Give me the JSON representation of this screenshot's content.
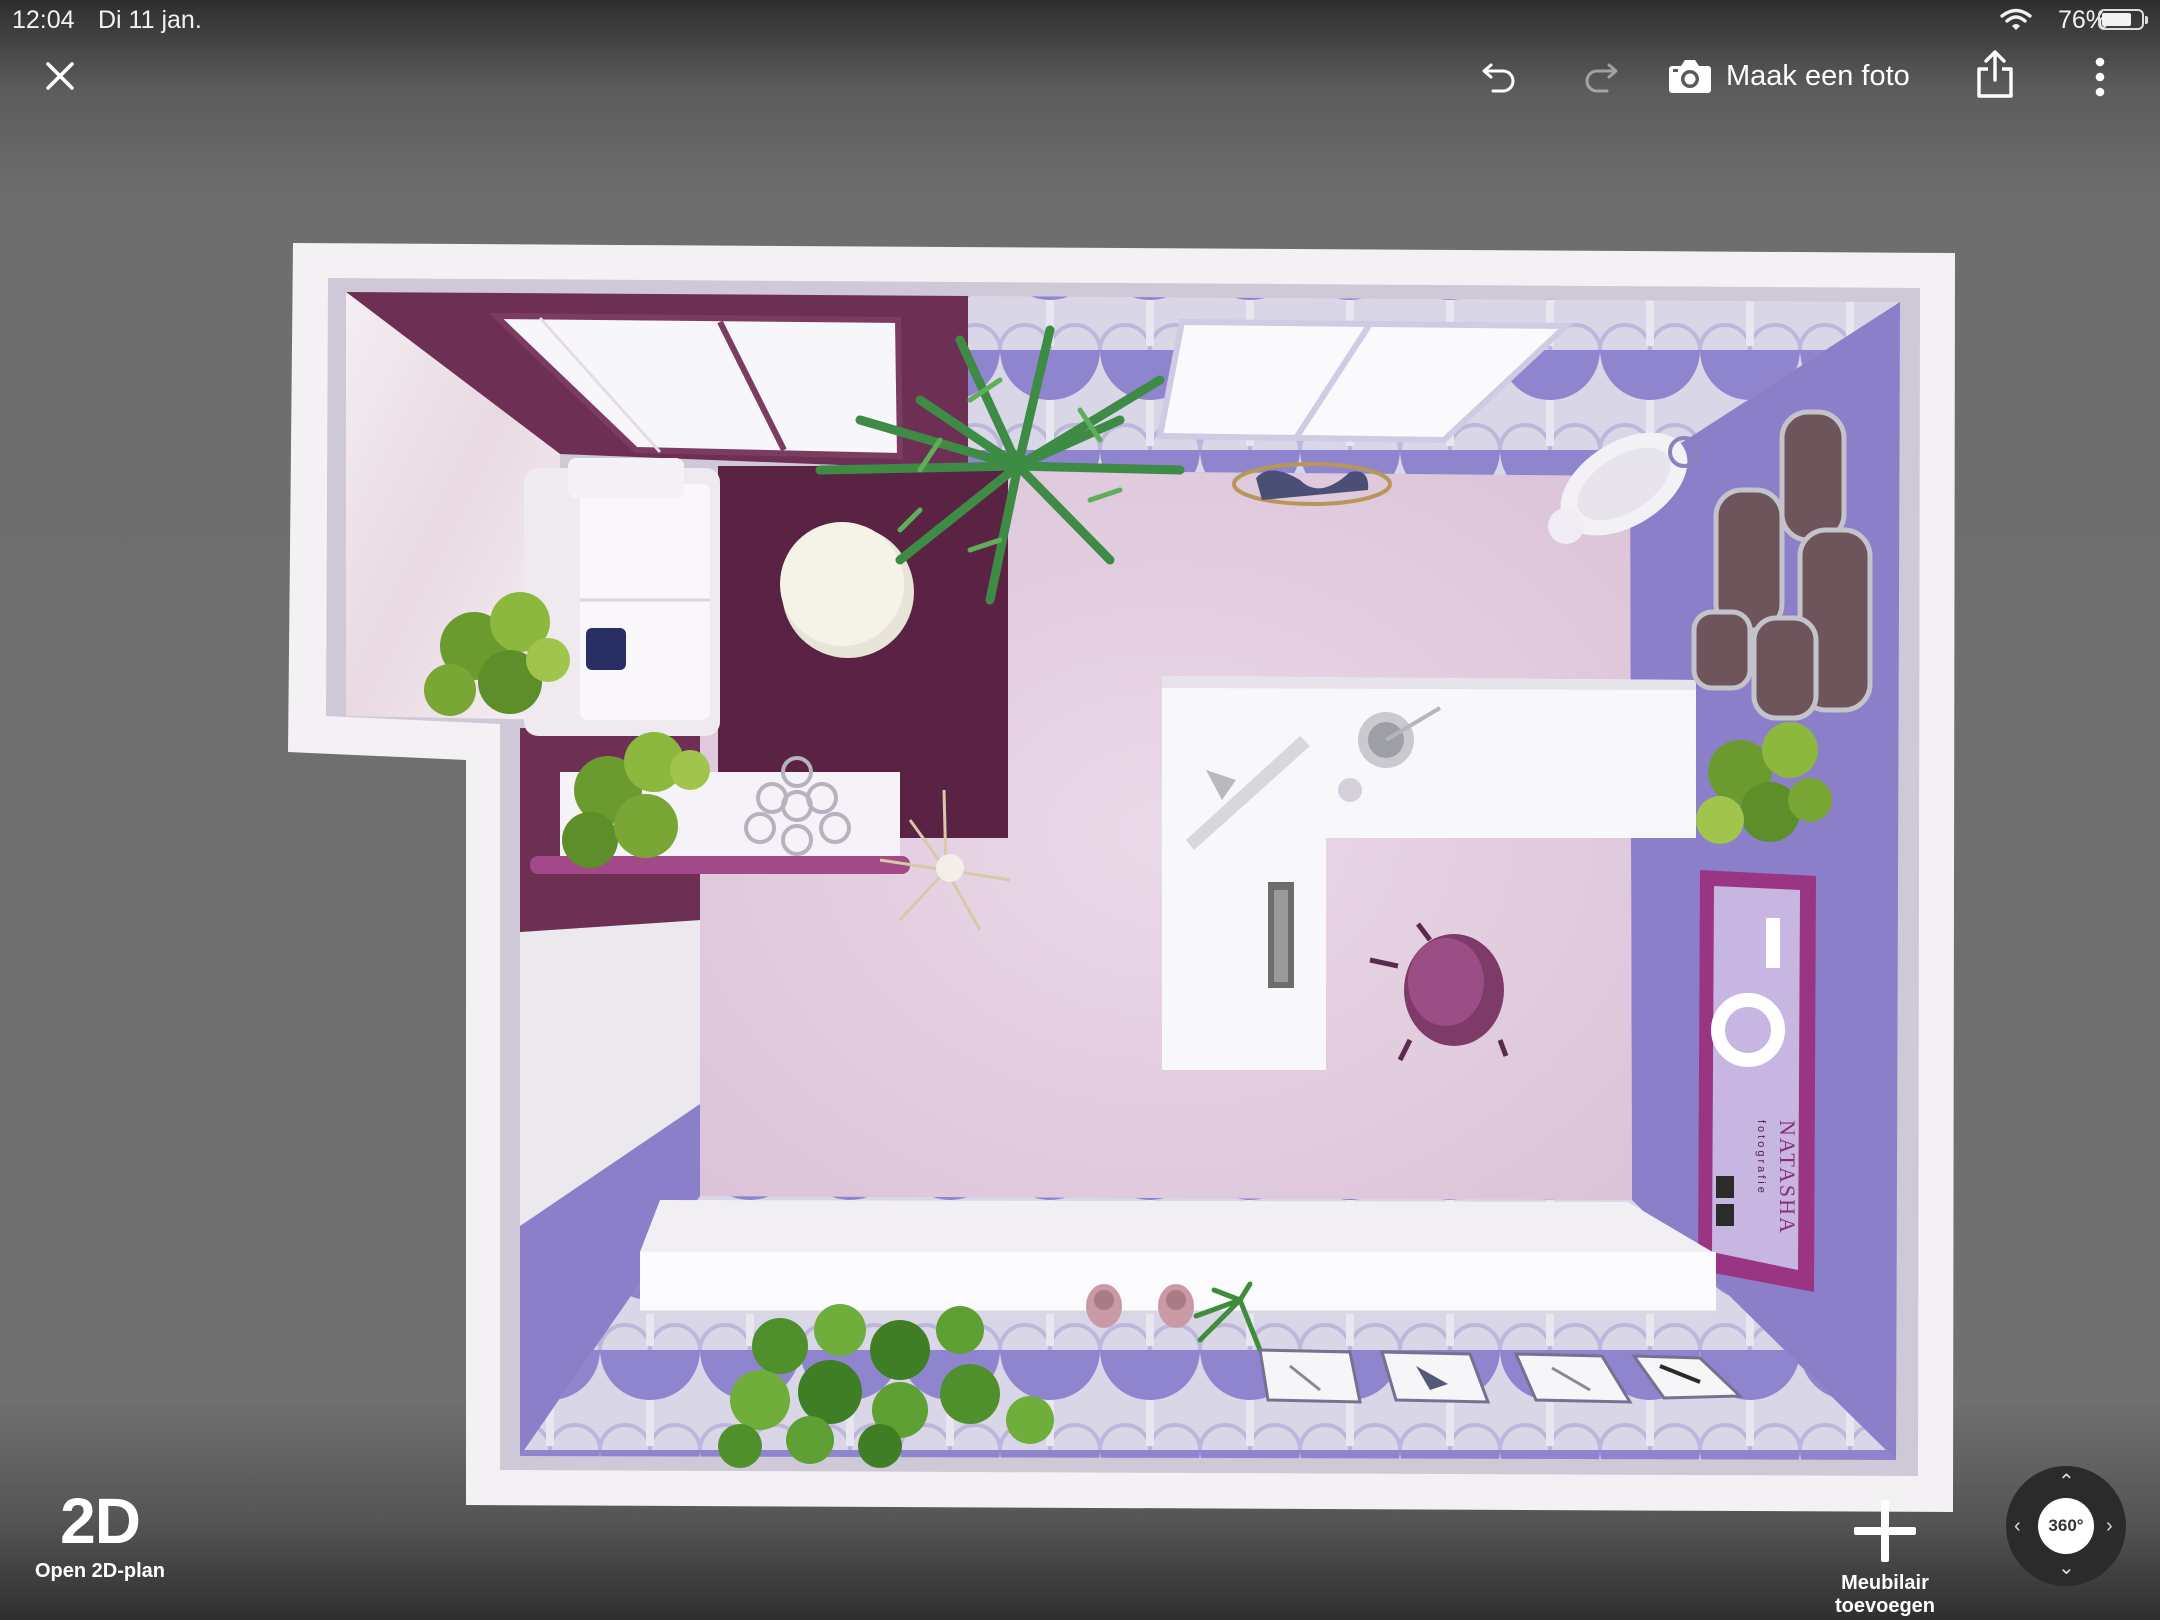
{
  "status_bar": {
    "time": "12:04",
    "date": "Di 11 jan.",
    "battery_percent": "76%",
    "battery_level": 0.76
  },
  "toolbar": {
    "photo_label": "Maak een foto",
    "close_icon": "close-icon",
    "undo_icon": "undo-icon",
    "redo_icon": "redo-icon",
    "share_icon": "share-icon",
    "more_icon": "more-icon"
  },
  "poster": {
    "name": "NATASHA",
    "subtitle": "fotografie"
  },
  "bottom": {
    "open2d_big": "2D",
    "open2d_label": "Open 2D-plan",
    "add_furniture_line1": "Meubilair",
    "add_furniture_line2": "toevoegen",
    "orbit_label": "360°"
  },
  "colors": {
    "floor": "#e6d3e3",
    "wall_purple": "#8b7fc9",
    "wall_plum": "#6e2f55",
    "rug": "#5a2343",
    "accent_magenta": "#9a3584"
  }
}
